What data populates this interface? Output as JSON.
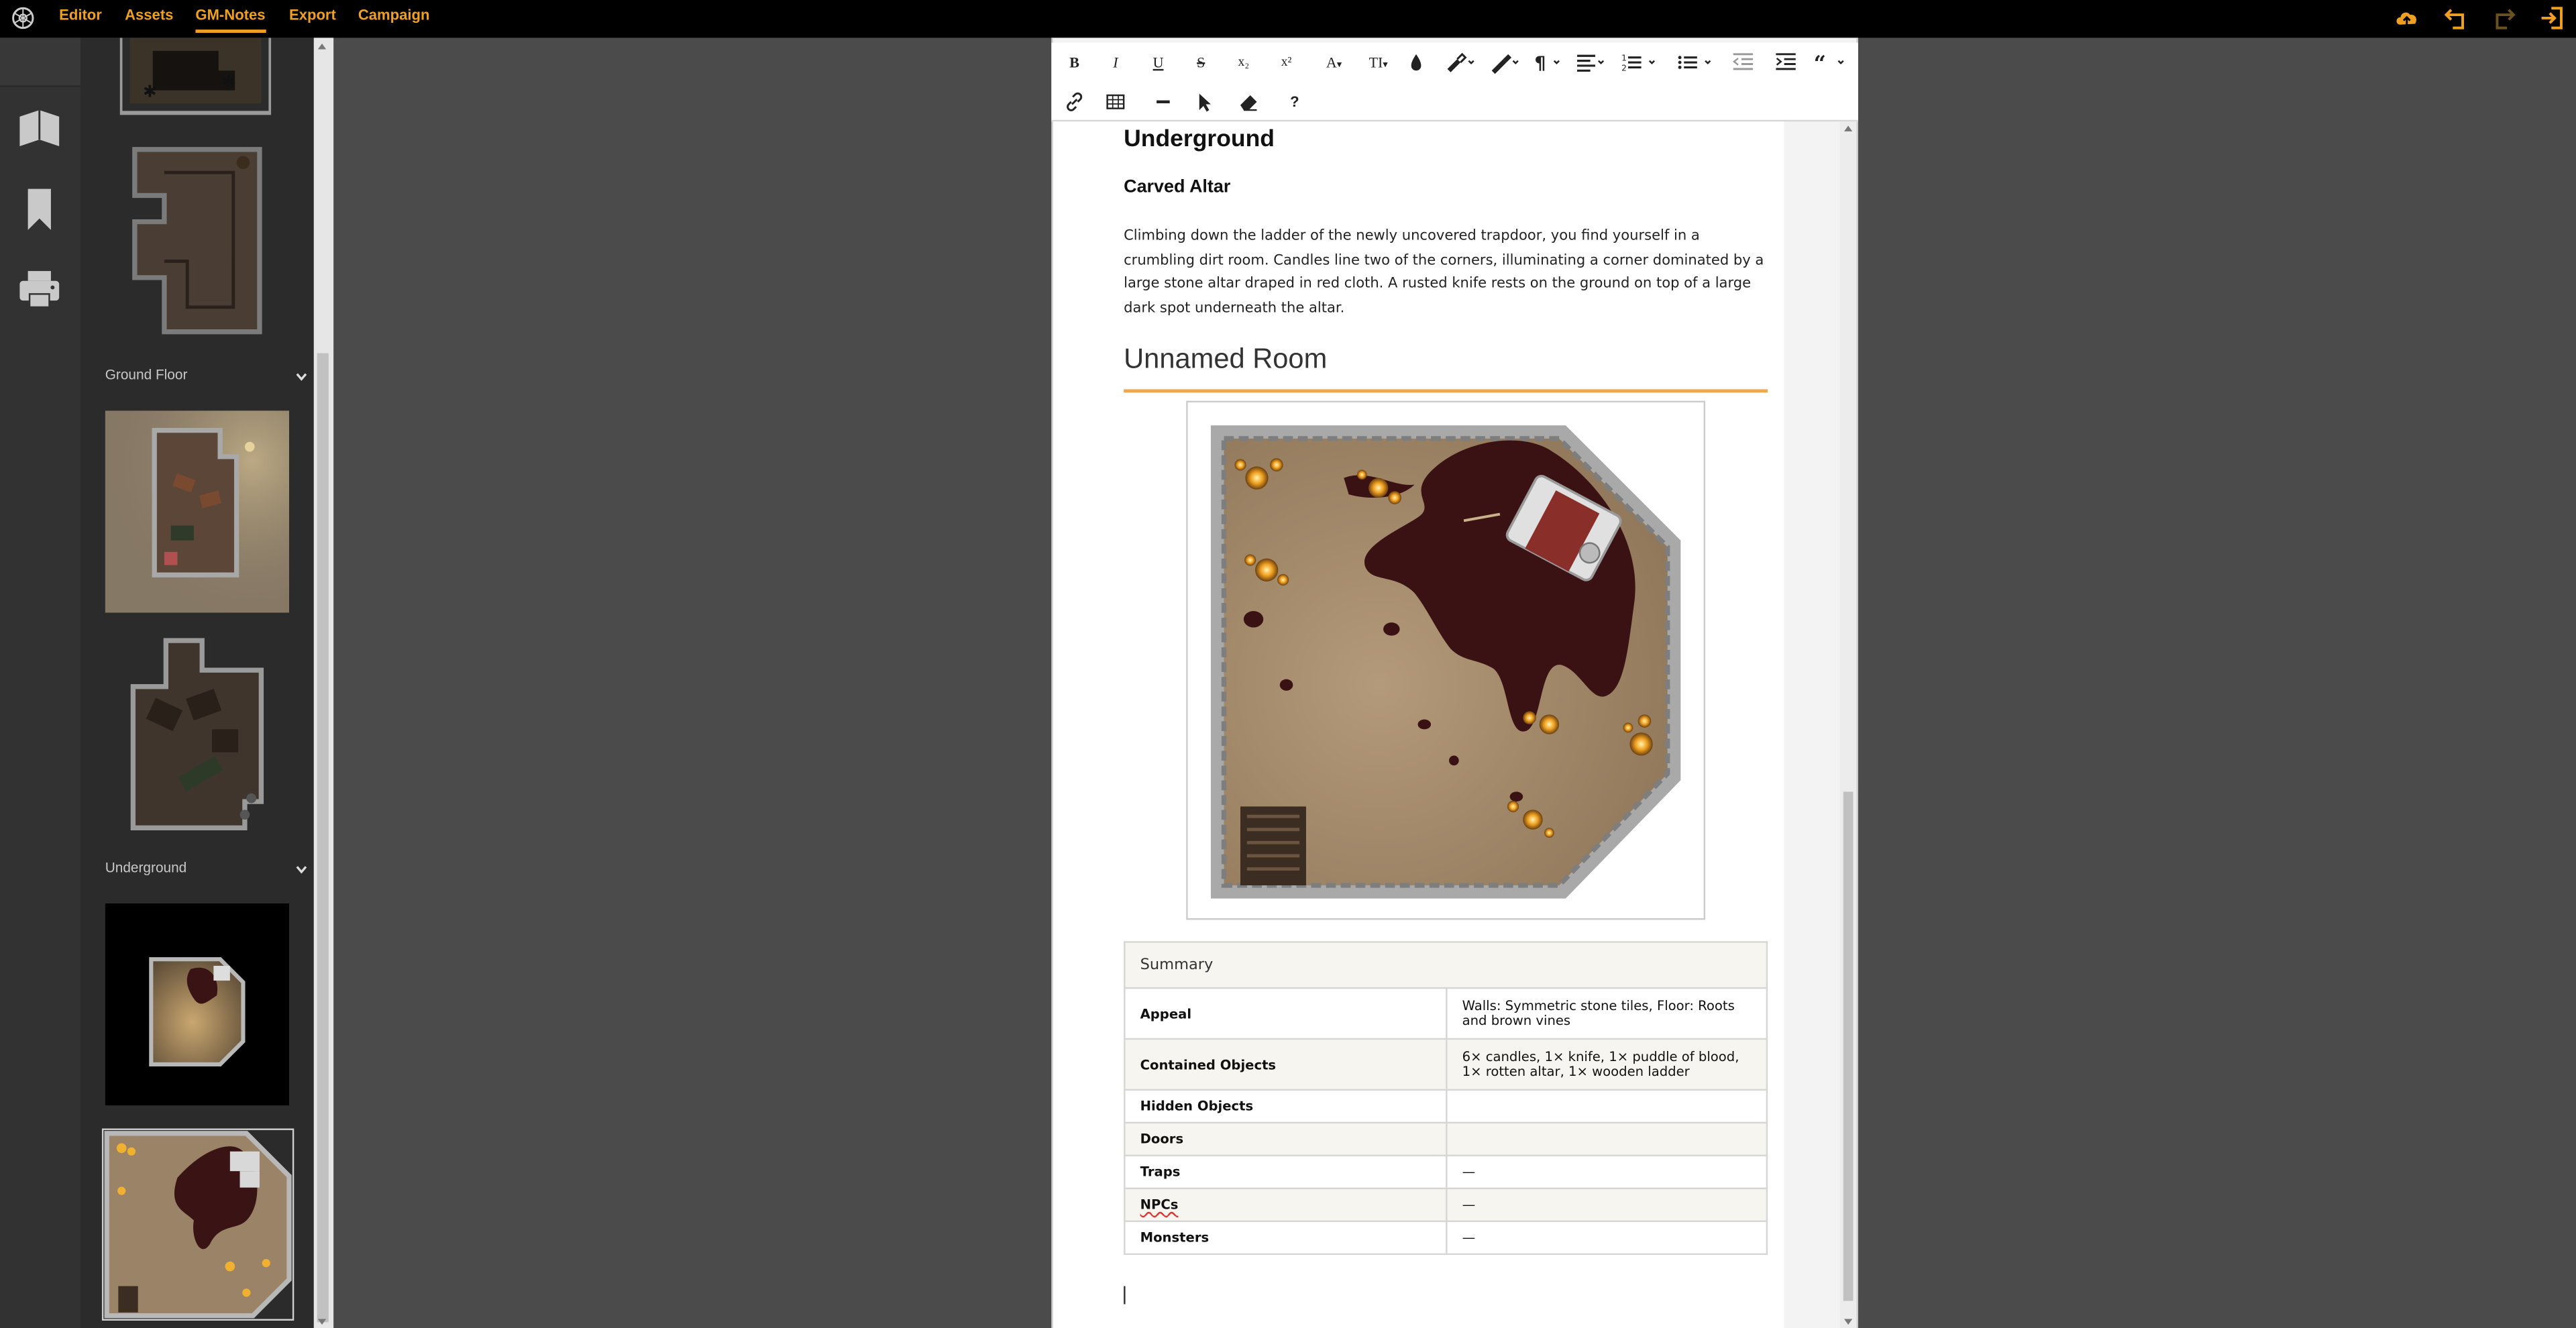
{
  "menu": {
    "items": [
      {
        "label": "Editor"
      },
      {
        "label": "Assets"
      },
      {
        "label": "GM-Notes"
      },
      {
        "label": "Export"
      },
      {
        "label": "Campaign"
      }
    ],
    "active": "GM-Notes",
    "accent": "#f0a020"
  },
  "top_icons": [
    "cloud-upload-icon",
    "undo-icon",
    "redo-icon",
    "logout-icon"
  ],
  "rail_icons": [
    "book-icon",
    "bookmark-icon",
    "print-icon"
  ],
  "panel": {
    "sections": [
      {
        "label": "Ground Floor"
      },
      {
        "label": "Underground"
      }
    ]
  },
  "doc": {
    "heading": "Underground",
    "subheading": "Carved Altar",
    "description": "Climbing down the ladder of the newly uncovered trapdoor, you find yourself in a crumbling dirt room. Candles line two of the corners, illuminating a corner dominated by a large stone altar draped in red cloth. A rusted knife rests on the ground on top of a large dark spot underneath the altar.",
    "room_title": "Unnamed Room",
    "summary": {
      "title": "Summary",
      "rows": [
        {
          "key": "Appeal",
          "value": "Walls: Symmetric stone tiles, Floor: Roots and brown vines"
        },
        {
          "key": "Contained Objects",
          "value": "6× candles, 1× knife, 1× puddle of blood, 1× rotten altar, 1× wooden ladder"
        },
        {
          "key": "Hidden Objects",
          "value": ""
        },
        {
          "key": "Doors",
          "value": ""
        },
        {
          "key": "Traps",
          "value": "—"
        },
        {
          "key": "NPCs",
          "value": "—"
        },
        {
          "key": "Monsters",
          "value": "—"
        }
      ]
    }
  },
  "toolbar": {
    "bold": "B",
    "italic": "I",
    "underline": "U",
    "strike": "S",
    "subscript": "x₂",
    "superscript": "x²",
    "font": "A",
    "size": "TI",
    "help": "?"
  }
}
